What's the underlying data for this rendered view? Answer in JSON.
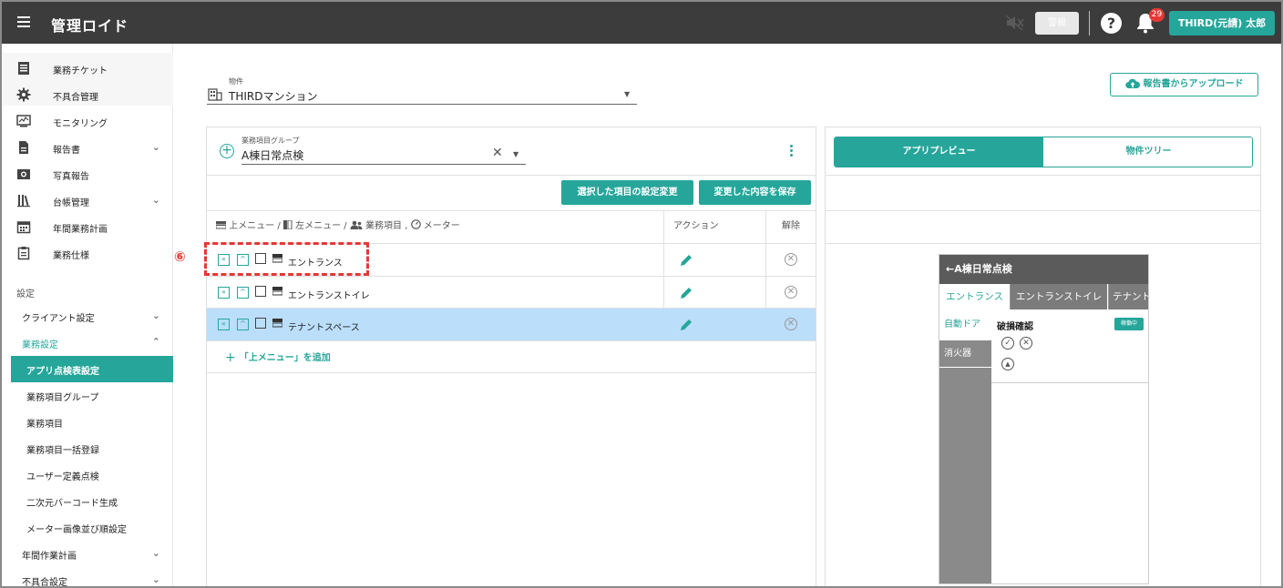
{
  "app": {
    "title": "管理ロイド"
  },
  "topbar": {
    "alarm_label": "警報",
    "help": "?",
    "notifications_count": "29",
    "user_name": "THIRD(元請) 太郎"
  },
  "sidebar": {
    "items": [
      {
        "label": "業務チケット",
        "icon": "document-icon"
      },
      {
        "label": "不具合管理",
        "icon": "gear-icon"
      },
      {
        "label": "モニタリング",
        "icon": "monitor-icon"
      },
      {
        "label": "報告書",
        "icon": "report-icon",
        "chevron": "⌄"
      },
      {
        "label": "写真報告",
        "icon": "camera-icon"
      },
      {
        "label": "台帳管理",
        "icon": "ledger-icon",
        "chevron": "⌄"
      },
      {
        "label": "年間業務計画",
        "icon": "calendar-icon"
      },
      {
        "label": "業務仕様",
        "icon": "clipboard-icon"
      }
    ],
    "section_label": "設定",
    "settings": [
      {
        "label": "クライアント設定",
        "chevron": "⌄"
      },
      {
        "label": "業務設定",
        "chevron": "⌃"
      }
    ],
    "children": [
      "アプリ点検表設定",
      "業務項目グループ",
      "業務項目",
      "業務項目一括登録",
      "ユーザー定義点検",
      "二次元バーコード生成",
      "メーター画像並び順設定"
    ],
    "bottom": [
      {
        "label": "年間作業計画",
        "chevron": "⌄"
      },
      {
        "label": "不具合設定",
        "chevron": "⌄"
      }
    ]
  },
  "property": {
    "label": "物件",
    "value": "THIRDマンション"
  },
  "upload_button": "報告書からアップロード",
  "group": {
    "label": "業務項目グループ",
    "value": "A棟日常点検",
    "clear": "✕"
  },
  "buttons": {
    "change_settings": "選択した項目の設定変更",
    "save": "変更した内容を保存"
  },
  "table": {
    "header_path": "上メニュー / 左メニュー / 業務項目 , メーター",
    "h_top_menu": "上メニュー",
    "h_left_menu": "左メニュー",
    "h_items": "業務項目",
    "h_meter": "メーター",
    "h_action": "アクション",
    "h_delete": "解除",
    "rows": [
      {
        "name": "エントランス"
      },
      {
        "name": "エントランストイレ"
      },
      {
        "name": "テナントスペース"
      }
    ],
    "add_label": "「上メニュー」を追加"
  },
  "annotation": {
    "number": "⑥",
    "color": "#e53935"
  },
  "right": {
    "tab_preview": "アプリプレビュー",
    "tab_tree": "物件ツリー",
    "preview": {
      "header": "←A棟日常点検",
      "tabs": [
        "エントランス",
        "エントランストイレ",
        "テナント"
      ],
      "side": [
        "自動ドア",
        "消火器"
      ],
      "item_title": "破損確認",
      "status": "稼働中",
      "ok": "✓",
      "ng": "✕",
      "up": "▲"
    }
  },
  "colors": {
    "accent": "#26a69a",
    "topbar": "#3c3c3c",
    "selected_row": "#bbdefb",
    "badge": "#e53935"
  }
}
